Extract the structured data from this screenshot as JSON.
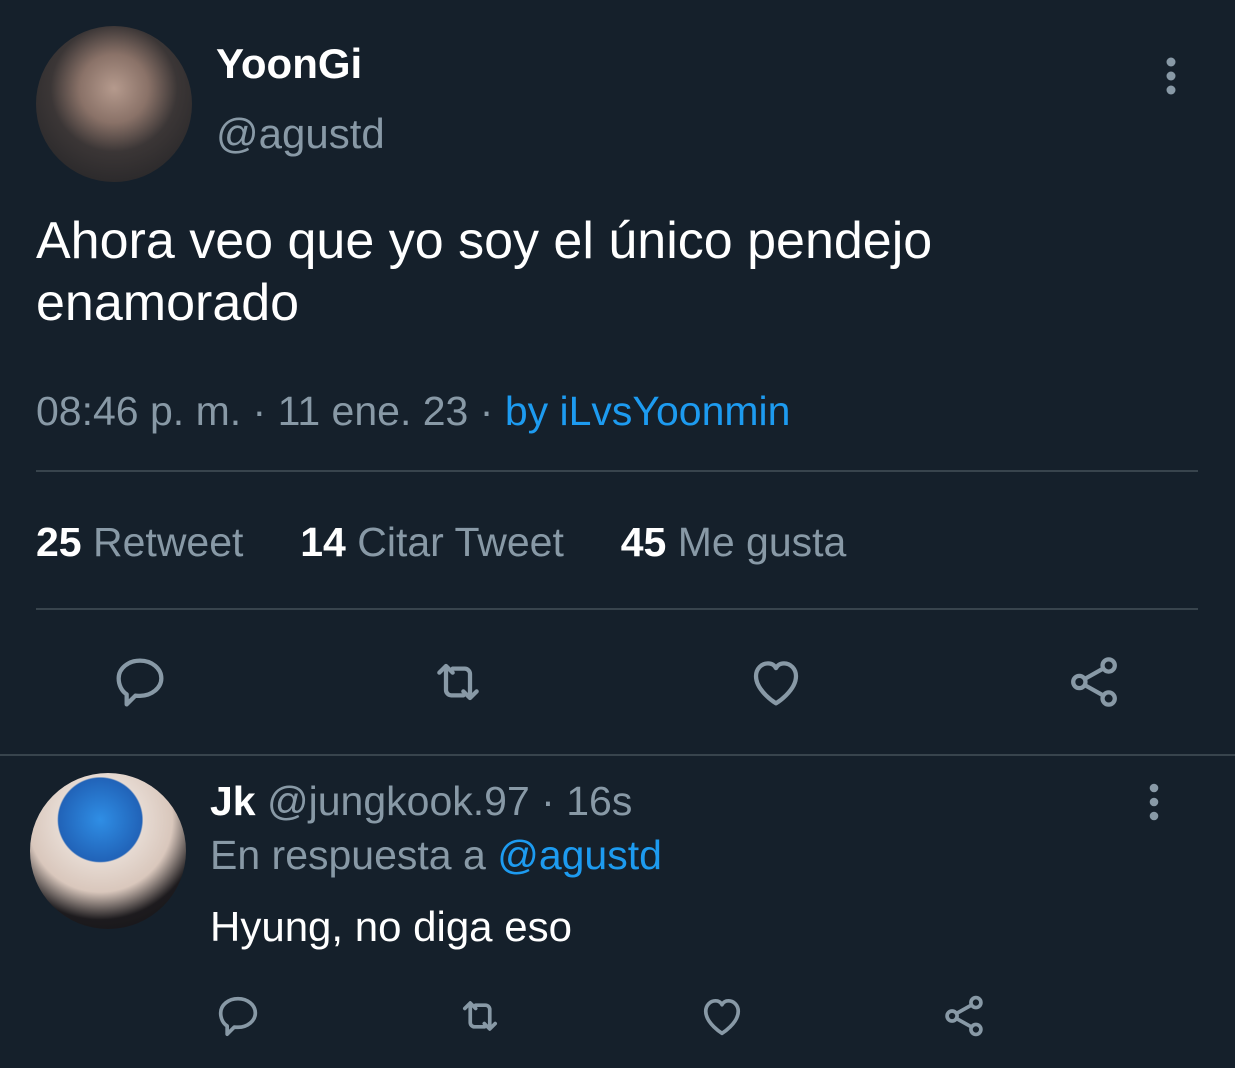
{
  "main_tweet": {
    "display_name": "YoonGi",
    "handle": "@agustd",
    "text": "Ahora veo que yo soy el único pendejo enamorado",
    "time": "08:46 p. m.",
    "separator": "·",
    "date": "11 ene. 23",
    "source": "by iLvsYoonmin",
    "stats": [
      {
        "count": "25",
        "label": "Retweet"
      },
      {
        "count": "14",
        "label": "Citar Tweet"
      },
      {
        "count": "45",
        "label": "Me gusta"
      }
    ],
    "actions": [
      "reply-icon",
      "retweet-icon",
      "like-icon",
      "share-icon"
    ]
  },
  "reply": {
    "display_name": "Jk",
    "handle": "@jungkook.97",
    "separator": "·",
    "age": "16s",
    "in_reply_prefix": "En respuesta a",
    "in_reply_handle": "@agustd",
    "text": "Hyung, no diga eso",
    "actions": [
      "reply-icon",
      "retweet-icon",
      "like-icon",
      "share-icon"
    ]
  },
  "colors": {
    "background": "#15202b",
    "divider": "#38444d",
    "secondary_text": "#8899a6",
    "link": "#1d9bf0",
    "primary_text": "#ffffff"
  }
}
